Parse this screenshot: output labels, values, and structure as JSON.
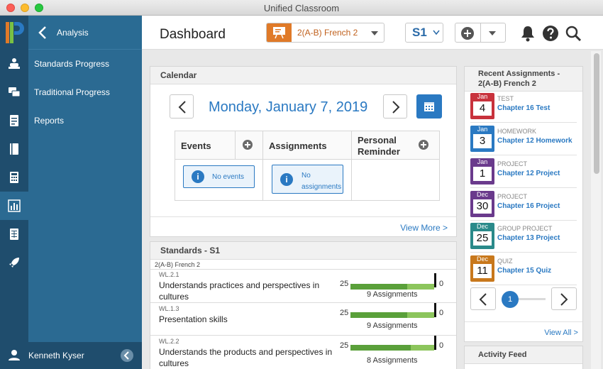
{
  "window": {
    "title": "Unified Classroom"
  },
  "menu": {
    "back_label": "Analysis",
    "items": [
      {
        "label": "Standards Progress"
      },
      {
        "label": "Traditional Progress"
      },
      {
        "label": "Reports"
      }
    ],
    "user_name": "Kenneth Kyser"
  },
  "header": {
    "title": "Dashboard",
    "class_name": "2(A-B) French 2",
    "term": "S1"
  },
  "calendar": {
    "section_title": "Calendar",
    "date": "Monday, January 7, 2019",
    "columns": [
      {
        "label": "Events",
        "empty_text": "No events"
      },
      {
        "label": "Assignments",
        "empty_text": "No assignments"
      },
      {
        "label": "Personal Reminder"
      }
    ],
    "view_more": "View More >"
  },
  "standards": {
    "section_title": "Standards - S1",
    "class_label": "2(A-B) French 2",
    "rows": [
      {
        "code": "WL.2.1",
        "name": "Understands practices and perspectives in cultures",
        "left_value": "25",
        "right_value": "0",
        "assignments": "9 Assignments",
        "fill": 0.68
      },
      {
        "code": "WL.1.3",
        "name": "Presentation skills",
        "left_value": "25",
        "right_value": "0",
        "assignments": "9 Assignments",
        "fill": 0.68
      },
      {
        "code": "WL.2.2",
        "name": "Understands the products and perspectives in cultures",
        "left_value": "25",
        "right_value": "0",
        "assignments": "8 Assignments",
        "fill": 0.72
      }
    ]
  },
  "recent": {
    "section_title": "Recent Assignments - 2(A-B) French 2",
    "items": [
      {
        "month": "Jan",
        "day": "4",
        "type": "TEST",
        "title": "Chapter 16 Test",
        "color": "#c8323c"
      },
      {
        "month": "Jan",
        "day": "3",
        "type": "HOMEWORK",
        "title": "Chapter 12 Homework",
        "color": "#2a79c2"
      },
      {
        "month": "Jan",
        "day": "1",
        "type": "PROJECT",
        "title": "Chapter 12 Project",
        "color": "#6a3a8c"
      },
      {
        "month": "Dec",
        "day": "30",
        "type": "PROJECT",
        "title": "Chapter 16 Project",
        "color": "#6a3a8c"
      },
      {
        "month": "Dec",
        "day": "25",
        "type": "GROUP PROJECT",
        "title": "Chapter 13 Project",
        "color": "#2a8a8a"
      },
      {
        "month": "Dec",
        "day": "11",
        "type": "QUIZ",
        "title": "Chapter 15 Quiz",
        "color": "#c8781c"
      }
    ],
    "page": "1",
    "view_all": "View All >"
  },
  "activity": {
    "section_title": "Activity Feed"
  },
  "colors": {
    "rail": "#1f4d6d",
    "menu": "#2b6a92",
    "accent": "#2a79c2",
    "class_icon": "#e07a28"
  }
}
